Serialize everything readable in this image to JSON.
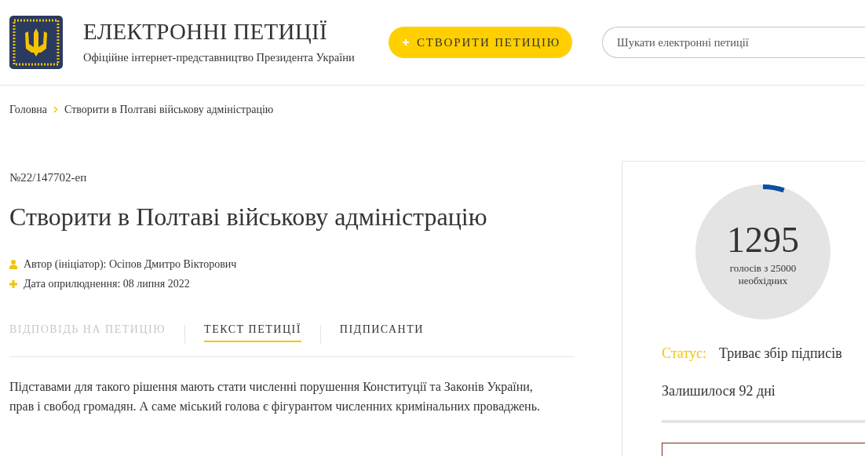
{
  "header": {
    "title": "ЕЛЕКТРОННІ ПЕТИЦІЇ",
    "subtitle": "Офіційне інтернет-представництво Президента України",
    "create_button": "СТВОРИТИ ПЕТИЦІЮ",
    "search": {
      "placeholder": "Шукати електронні петиції"
    }
  },
  "breadcrumbs": [
    {
      "label": "Головна"
    },
    {
      "label": "Створити в Полтаві військову адміністрацію"
    }
  ],
  "petition": {
    "number": "№22/147702-еп",
    "title": "Створити в Полтаві військову адміністрацію",
    "meta": [
      {
        "kind": "author",
        "text": "Автор (ініціатор): Осіпов Дмитро Вікторович"
      },
      {
        "kind": "date",
        "text": "Дата оприлюднення: 08 липня 2022"
      }
    ],
    "tabs": [
      {
        "label": "ВІДПОВІДЬ НА ПЕТИЦІЮ",
        "selected": false,
        "disabled": true
      },
      {
        "label": "ТЕКСТ ПЕТИЦІЇ",
        "selected": true,
        "disabled": false
      },
      {
        "label": "ПІДПИСАНТИ",
        "selected": false,
        "disabled": false
      }
    ],
    "text": "Підставами для такого рішення мають стати численні порушення Конституції та Законів України, прав і свобод громадян. А саме міський голова є фігурантом численних кримінальних проваджень."
  },
  "progress": {
    "count": "1295",
    "caption": "голосів з 25000 необхідних",
    "status_label": "Статус:",
    "status": "Триває збір підписів",
    "remaining": "Залишилося 92 дні"
  }
}
